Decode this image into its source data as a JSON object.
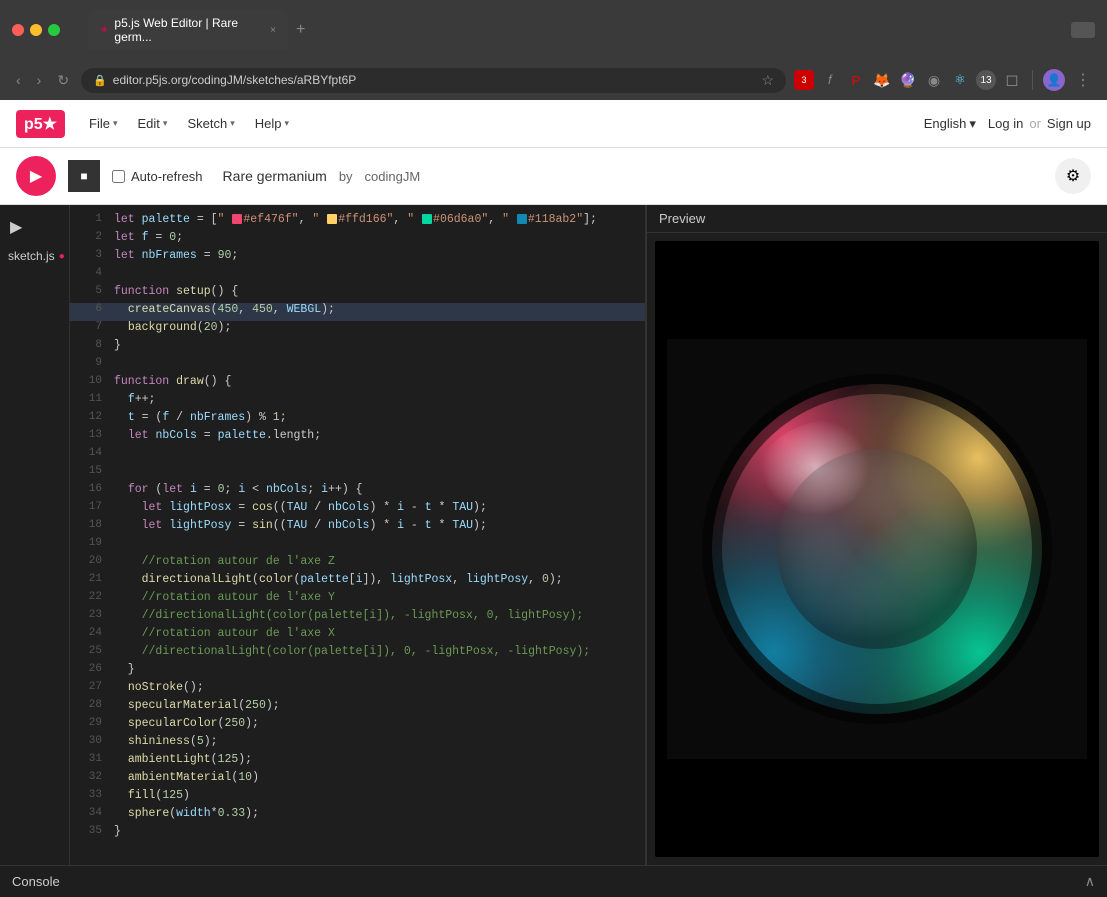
{
  "browser": {
    "tab_title": "p5.js Web Editor | Rare germ...",
    "tab_favicon": "✳",
    "url": "editor.p5js.org/codingJM/sketches/aRBYfpt6P",
    "new_tab_label": "+",
    "back_label": "‹",
    "forward_label": "›",
    "refresh_label": "↻",
    "more_label": "⋮",
    "extensions": [
      "3",
      "f",
      "P",
      "🦊",
      "🔮",
      "⊙",
      "⚛",
      "13",
      "◻",
      "👤"
    ]
  },
  "app": {
    "logo": "p5★",
    "menu": {
      "file": "File",
      "edit": "Edit",
      "sketch": "Sketch",
      "help": "Help"
    },
    "language": "English",
    "login": "Log in",
    "or": "or",
    "signup": "Sign up"
  },
  "toolbar": {
    "play_label": "▶",
    "stop_label": "■",
    "auto_refresh_label": "Auto-refresh",
    "sketch_name": "Rare germanium",
    "by_label": "by",
    "author": "codingJM",
    "settings_label": "⚙"
  },
  "editor": {
    "filename": "sketch.js",
    "unsaved_dot": "●",
    "preview_label": "Preview",
    "lines": [
      {
        "num": 1,
        "content": "let palette = [\" #ef476f\", \" #ffd166\", \" #06d6a0\", \" #118ab2\"];"
      },
      {
        "num": 2,
        "content": "let f = 0;"
      },
      {
        "num": 3,
        "content": "let nbFrames = 90;"
      },
      {
        "num": 4,
        "content": ""
      },
      {
        "num": 5,
        "content": "function setup() {"
      },
      {
        "num": 6,
        "content": "  createCanvas(450, 450, WEBGL);"
      },
      {
        "num": 7,
        "content": "  background(20);"
      },
      {
        "num": 8,
        "content": "}"
      },
      {
        "num": 9,
        "content": ""
      },
      {
        "num": 10,
        "content": "function draw() {"
      },
      {
        "num": 11,
        "content": "  f++;"
      },
      {
        "num": 12,
        "content": "  t = (f / nbFrames) % 1;"
      },
      {
        "num": 13,
        "content": "  let nbCols = palette.length;"
      },
      {
        "num": 14,
        "content": ""
      },
      {
        "num": 15,
        "content": ""
      },
      {
        "num": 16,
        "content": "  for (let i = 0; i < nbCols; i++) {"
      },
      {
        "num": 17,
        "content": "    let lightPosx = cos((TAU / nbCols) * i - t * TAU);"
      },
      {
        "num": 18,
        "content": "    let lightPosy = sin((TAU / nbCols) * i - t * TAU);"
      },
      {
        "num": 19,
        "content": ""
      },
      {
        "num": 20,
        "content": "    //rotation autour de l'axe Z"
      },
      {
        "num": 21,
        "content": "    directionalLight(color(palette[i]), lightPosx, lightPosy, 0);"
      },
      {
        "num": 22,
        "content": "    //rotation autour de l'axe Y"
      },
      {
        "num": 23,
        "content": "    //directionalLight(color(palette[i]), -lightPosx, 0, lightPosy);"
      },
      {
        "num": 24,
        "content": "    //rotation autour de l'axe X"
      },
      {
        "num": 25,
        "content": "    //directionalLight(color(palette[i]), 0, -lightPosx, -lightPosy);"
      },
      {
        "num": 26,
        "content": "  }"
      },
      {
        "num": 27,
        "content": "  noStroke();"
      },
      {
        "num": 28,
        "content": "  specularMaterial(250);"
      },
      {
        "num": 29,
        "content": "  specularColor(250);"
      },
      {
        "num": 30,
        "content": "  shininess(5);"
      },
      {
        "num": 31,
        "content": "  ambientLight(125);"
      },
      {
        "num": 32,
        "content": "  ambientMaterial(10)"
      },
      {
        "num": 33,
        "content": "  fill(125)"
      },
      {
        "num": 34,
        "content": "  sphere(width*0.33);"
      },
      {
        "num": 35,
        "content": "}"
      }
    ]
  },
  "console": {
    "label": "Console",
    "toggle": "∧"
  },
  "colors": {
    "p5_red": "#ed225d",
    "palette_1": "#ef476f",
    "palette_2": "#ffd166",
    "palette_3": "#06d6a0",
    "palette_4": "#118ab2"
  }
}
